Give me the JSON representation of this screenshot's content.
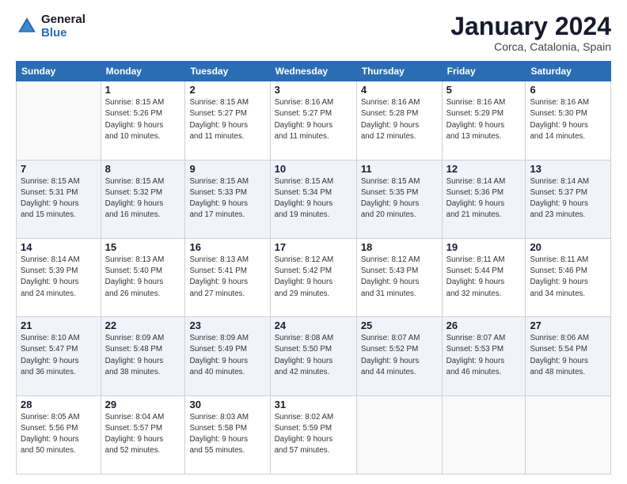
{
  "logo": {
    "line1": "General",
    "line2": "Blue"
  },
  "title": "January 2024",
  "subtitle": "Corca, Catalonia, Spain",
  "weekdays": [
    "Sunday",
    "Monday",
    "Tuesday",
    "Wednesday",
    "Thursday",
    "Friday",
    "Saturday"
  ],
  "weeks": [
    [
      {
        "day": "",
        "info": ""
      },
      {
        "day": "1",
        "info": "Sunrise: 8:15 AM\nSunset: 5:26 PM\nDaylight: 9 hours\nand 10 minutes."
      },
      {
        "day": "2",
        "info": "Sunrise: 8:15 AM\nSunset: 5:27 PM\nDaylight: 9 hours\nand 11 minutes."
      },
      {
        "day": "3",
        "info": "Sunrise: 8:16 AM\nSunset: 5:27 PM\nDaylight: 9 hours\nand 11 minutes."
      },
      {
        "day": "4",
        "info": "Sunrise: 8:16 AM\nSunset: 5:28 PM\nDaylight: 9 hours\nand 12 minutes."
      },
      {
        "day": "5",
        "info": "Sunrise: 8:16 AM\nSunset: 5:29 PM\nDaylight: 9 hours\nand 13 minutes."
      },
      {
        "day": "6",
        "info": "Sunrise: 8:16 AM\nSunset: 5:30 PM\nDaylight: 9 hours\nand 14 minutes."
      }
    ],
    [
      {
        "day": "7",
        "info": "Sunrise: 8:15 AM\nSunset: 5:31 PM\nDaylight: 9 hours\nand 15 minutes."
      },
      {
        "day": "8",
        "info": "Sunrise: 8:15 AM\nSunset: 5:32 PM\nDaylight: 9 hours\nand 16 minutes."
      },
      {
        "day": "9",
        "info": "Sunrise: 8:15 AM\nSunset: 5:33 PM\nDaylight: 9 hours\nand 17 minutes."
      },
      {
        "day": "10",
        "info": "Sunrise: 8:15 AM\nSunset: 5:34 PM\nDaylight: 9 hours\nand 19 minutes."
      },
      {
        "day": "11",
        "info": "Sunrise: 8:15 AM\nSunset: 5:35 PM\nDaylight: 9 hours\nand 20 minutes."
      },
      {
        "day": "12",
        "info": "Sunrise: 8:14 AM\nSunset: 5:36 PM\nDaylight: 9 hours\nand 21 minutes."
      },
      {
        "day": "13",
        "info": "Sunrise: 8:14 AM\nSunset: 5:37 PM\nDaylight: 9 hours\nand 23 minutes."
      }
    ],
    [
      {
        "day": "14",
        "info": "Sunrise: 8:14 AM\nSunset: 5:39 PM\nDaylight: 9 hours\nand 24 minutes."
      },
      {
        "day": "15",
        "info": "Sunrise: 8:13 AM\nSunset: 5:40 PM\nDaylight: 9 hours\nand 26 minutes."
      },
      {
        "day": "16",
        "info": "Sunrise: 8:13 AM\nSunset: 5:41 PM\nDaylight: 9 hours\nand 27 minutes."
      },
      {
        "day": "17",
        "info": "Sunrise: 8:12 AM\nSunset: 5:42 PM\nDaylight: 9 hours\nand 29 minutes."
      },
      {
        "day": "18",
        "info": "Sunrise: 8:12 AM\nSunset: 5:43 PM\nDaylight: 9 hours\nand 31 minutes."
      },
      {
        "day": "19",
        "info": "Sunrise: 8:11 AM\nSunset: 5:44 PM\nDaylight: 9 hours\nand 32 minutes."
      },
      {
        "day": "20",
        "info": "Sunrise: 8:11 AM\nSunset: 5:46 PM\nDaylight: 9 hours\nand 34 minutes."
      }
    ],
    [
      {
        "day": "21",
        "info": "Sunrise: 8:10 AM\nSunset: 5:47 PM\nDaylight: 9 hours\nand 36 minutes."
      },
      {
        "day": "22",
        "info": "Sunrise: 8:09 AM\nSunset: 5:48 PM\nDaylight: 9 hours\nand 38 minutes."
      },
      {
        "day": "23",
        "info": "Sunrise: 8:09 AM\nSunset: 5:49 PM\nDaylight: 9 hours\nand 40 minutes."
      },
      {
        "day": "24",
        "info": "Sunrise: 8:08 AM\nSunset: 5:50 PM\nDaylight: 9 hours\nand 42 minutes."
      },
      {
        "day": "25",
        "info": "Sunrise: 8:07 AM\nSunset: 5:52 PM\nDaylight: 9 hours\nand 44 minutes."
      },
      {
        "day": "26",
        "info": "Sunrise: 8:07 AM\nSunset: 5:53 PM\nDaylight: 9 hours\nand 46 minutes."
      },
      {
        "day": "27",
        "info": "Sunrise: 8:06 AM\nSunset: 5:54 PM\nDaylight: 9 hours\nand 48 minutes."
      }
    ],
    [
      {
        "day": "28",
        "info": "Sunrise: 8:05 AM\nSunset: 5:56 PM\nDaylight: 9 hours\nand 50 minutes."
      },
      {
        "day": "29",
        "info": "Sunrise: 8:04 AM\nSunset: 5:57 PM\nDaylight: 9 hours\nand 52 minutes."
      },
      {
        "day": "30",
        "info": "Sunrise: 8:03 AM\nSunset: 5:58 PM\nDaylight: 9 hours\nand 55 minutes."
      },
      {
        "day": "31",
        "info": "Sunrise: 8:02 AM\nSunset: 5:59 PM\nDaylight: 9 hours\nand 57 minutes."
      },
      {
        "day": "",
        "info": ""
      },
      {
        "day": "",
        "info": ""
      },
      {
        "day": "",
        "info": ""
      }
    ]
  ]
}
